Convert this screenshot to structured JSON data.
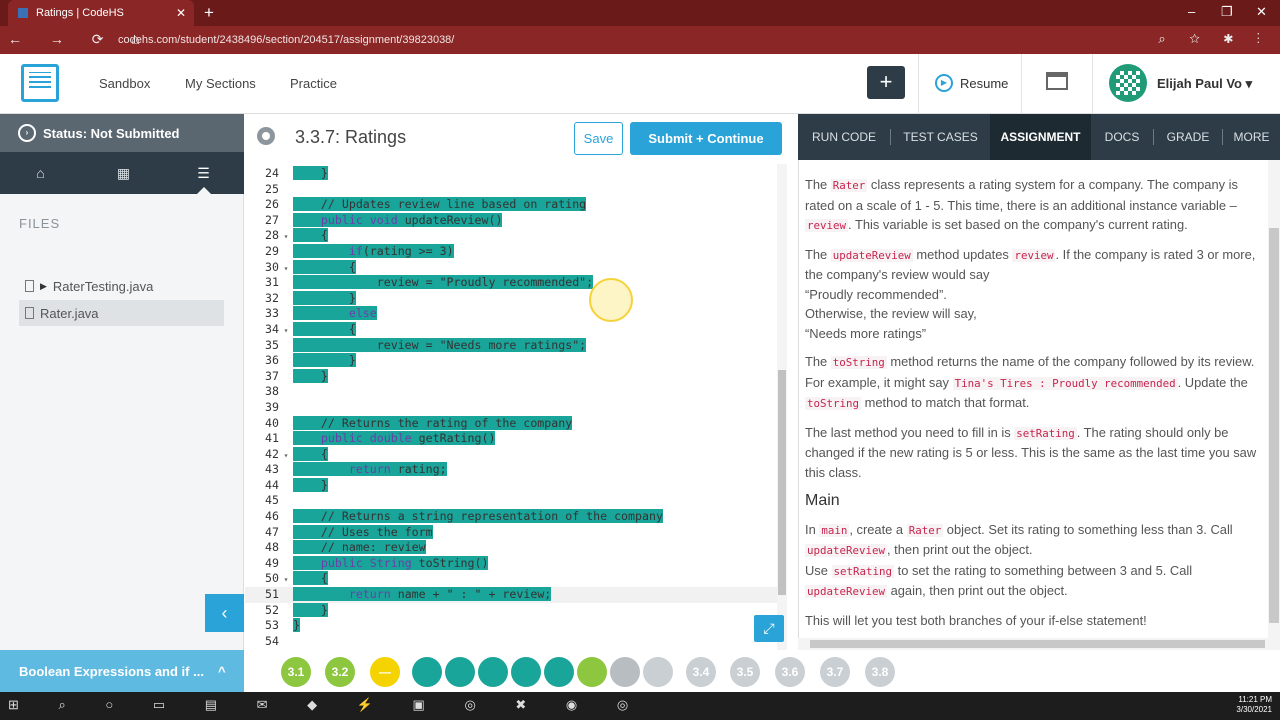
{
  "browser": {
    "tab_title": "Ratings | CodeHS",
    "url": "codehs.com/student/2438496/section/204517/assignment/39823038/",
    "new_tab": "+",
    "close": "✕",
    "minimize": "–",
    "restore": "❐",
    "window_close": "✕",
    "nav": "← → ⟳ ⌂",
    "url_icons": "⌕ ☆ ✱ ⋮"
  },
  "header": {
    "nav": [
      "Sandbox",
      "My Sections",
      "Practice"
    ],
    "plus": "+",
    "resume": "Resume",
    "username": "Elijah Paul Vo",
    "dropdown": "▾"
  },
  "left": {
    "status": "Status: Not Submitted",
    "status_icon": "›",
    "tabs": [
      "⌂",
      "▦",
      "☰"
    ],
    "files_heading": "FILES",
    "files": [
      "RaterTesting.java",
      "Rater.java"
    ],
    "collapse": "‹",
    "lesson": "Boolean Expressions and if ...",
    "lesson_caret": "^"
  },
  "editor": {
    "title": "3.3.7: Ratings",
    "save": "Save",
    "submit": "Submit + Continue",
    "expand": "⤢",
    "lines": [
      {
        "n": "24",
        "fold": "",
        "code": "    }"
      },
      {
        "n": "25",
        "fold": "",
        "code": ""
      },
      {
        "n": "26",
        "fold": "",
        "code": "    // Updates review line based on rating"
      },
      {
        "n": "27",
        "fold": "",
        "code": "    public void updateReview()"
      },
      {
        "n": "28",
        "fold": "▾",
        "code": "    {"
      },
      {
        "n": "29",
        "fold": "",
        "code": "        if(rating >= 3)"
      },
      {
        "n": "30",
        "fold": "▾",
        "code": "        {"
      },
      {
        "n": "31",
        "fold": "",
        "code": "            review = \"Proudly recommended\";"
      },
      {
        "n": "32",
        "fold": "",
        "code": "        }"
      },
      {
        "n": "33",
        "fold": "",
        "code": "        else"
      },
      {
        "n": "34",
        "fold": "▾",
        "code": "        {"
      },
      {
        "n": "35",
        "fold": "",
        "code": "            review = \"Needs more ratings\";"
      },
      {
        "n": "36",
        "fold": "",
        "code": "        }"
      },
      {
        "n": "37",
        "fold": "",
        "code": "    }"
      },
      {
        "n": "38",
        "fold": "",
        "code": ""
      },
      {
        "n": "39",
        "fold": "",
        "code": ""
      },
      {
        "n": "40",
        "fold": "",
        "code": "    // Returns the rating of the company"
      },
      {
        "n": "41",
        "fold": "",
        "code": "    public double getRating()"
      },
      {
        "n": "42",
        "fold": "▾",
        "code": "    {"
      },
      {
        "n": "43",
        "fold": "",
        "code": "        return rating;"
      },
      {
        "n": "44",
        "fold": "",
        "code": "    }"
      },
      {
        "n": "45",
        "fold": "",
        "code": ""
      },
      {
        "n": "46",
        "fold": "",
        "code": "    // Returns a string representation of the company"
      },
      {
        "n": "47",
        "fold": "",
        "code": "    // Uses the form"
      },
      {
        "n": "48",
        "fold": "",
        "code": "    // name: review"
      },
      {
        "n": "49",
        "fold": "",
        "code": "    public String toString()"
      },
      {
        "n": "50",
        "fold": "▾",
        "code": "    {"
      },
      {
        "n": "51",
        "fold": "",
        "code": "        return name + \" : \" + review;"
      },
      {
        "n": "52",
        "fold": "",
        "code": "    }"
      },
      {
        "n": "53",
        "fold": "",
        "code": "}"
      },
      {
        "n": "54",
        "fold": "",
        "code": ""
      }
    ]
  },
  "right": {
    "tabs": [
      "RUN CODE",
      "TEST CASES",
      "ASSIGNMENT",
      "DOCS",
      "GRADE",
      "MORE"
    ],
    "p1": {
      "a": "The ",
      "c1": "Rater",
      "b": " class represents a rating system for a company. The company is rated on a scale of 1 - 5. This time, there is an additional instance variable – ",
      "c2": "review",
      "d": ". This variable is set based on the company's current rating."
    },
    "p2": {
      "a": "The ",
      "c1": "updateReview",
      "b": " method updates ",
      "c2": "review",
      "d": ". If the company is rated 3 or more, the company's review would say",
      "e": "“Proudly recommended”.",
      "f": "Otherwise, the review will say,",
      "g": "“Needs more ratings”"
    },
    "p3": {
      "a": "The ",
      "c1": "toString",
      "b": " method returns the name of the company followed by its review. For example, it might say ",
      "c2": "Tina's Tires : Proudly recommended",
      "d": ". Update the ",
      "c3": "toString",
      "e": " method to match that format."
    },
    "p4": {
      "a": "The last method you need to fill in is ",
      "c1": "setRating",
      "b": ". The rating should only be changed if the new rating is 5 or less. This is the same as the last time you saw this class."
    },
    "main_heading": "Main",
    "p5": {
      "a": "In ",
      "c1": "main",
      "b": ", create a ",
      "c2": "Rater",
      "d": " object. Set its rating to something less than 3. Call ",
      "c3": "updateReview",
      "e": ", then print out the object.",
      "f": "Use ",
      "c4": "setRating",
      "g": " to set the rating to something between 3 and 5. Call ",
      "c5": "updateReview",
      "h": " again, then print out the object."
    },
    "p6": "This will let you test both branches of your if-else statement!"
  },
  "progress": {
    "items": [
      "3.1",
      "3.2",
      "—",
      "",
      "",
      "",
      "",
      "",
      "",
      "",
      "",
      "",
      "3.4",
      "3.5",
      "3.6",
      "3.7",
      "3.8"
    ]
  },
  "taskbar": {
    "icons": "⊞ ⌕ ○ ▭ ▤ ✉ ◆ ⚡ ▣ ◎ ✖ ◉ ◎",
    "time": "11:21 PM",
    "date": "3/30/2021"
  }
}
